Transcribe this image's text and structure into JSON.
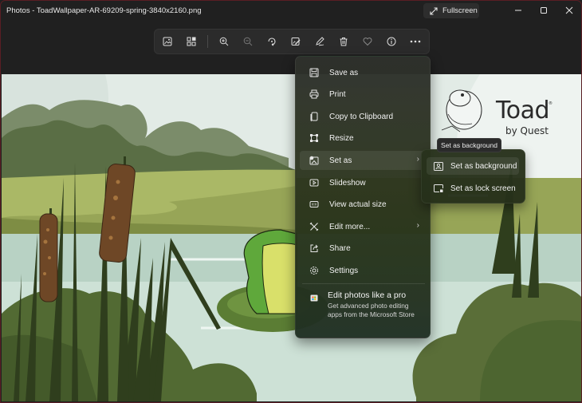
{
  "window": {
    "title": "Photos - ToadWallpaper-AR-69209-spring-3840x2160.png",
    "fullscreen_label": "Fullscreen",
    "accent_border": "#5a1e24"
  },
  "toolbar": {
    "buttons": [
      {
        "icon": "image-view-icon",
        "label": "View image"
      },
      {
        "icon": "gallery-icon",
        "label": "Gallery"
      },
      {
        "icon": "zoom-in-icon",
        "label": "Zoom in"
      },
      {
        "icon": "zoom-out-icon",
        "label": "Zoom out"
      },
      {
        "icon": "rotate-icon",
        "label": "Rotate"
      },
      {
        "icon": "edit-image-icon",
        "label": "Edit image"
      },
      {
        "icon": "markup-icon",
        "label": "Markup"
      },
      {
        "icon": "delete-icon",
        "label": "Delete"
      },
      {
        "icon": "favorite-icon",
        "label": "Favorite"
      },
      {
        "icon": "info-icon",
        "label": "File info"
      },
      {
        "icon": "more-icon",
        "label": "See more"
      }
    ]
  },
  "menu": {
    "items": [
      {
        "label": "Save as",
        "icon": "save-icon"
      },
      {
        "label": "Print",
        "icon": "print-icon"
      },
      {
        "label": "Copy to Clipboard",
        "icon": "copy-icon"
      },
      {
        "label": "Resize",
        "icon": "resize-icon"
      },
      {
        "label": "Set as",
        "icon": "set-as-icon",
        "has_submenu": true
      },
      {
        "label": "Slideshow",
        "icon": "slideshow-icon"
      },
      {
        "label": "View actual size",
        "icon": "actual-size-icon"
      },
      {
        "label": "Edit more...",
        "icon": "edit-more-icon",
        "has_submenu": true
      },
      {
        "label": "Share",
        "icon": "share-icon"
      },
      {
        "label": "Settings",
        "icon": "settings-icon"
      }
    ],
    "chevron": "›",
    "promo": {
      "title": "Edit photos like a pro",
      "description": "Get advanced photo editing apps from the Microsoft Store",
      "icon": "store-icon"
    }
  },
  "submenu": {
    "items": [
      {
        "label": "Set as background",
        "icon": "background-icon"
      },
      {
        "label": "Set as lock screen",
        "icon": "lock-screen-icon"
      }
    ]
  },
  "tooltip": {
    "text": "Set as background"
  },
  "image": {
    "logo_main": "Toad",
    "logo_sub": "by Quest",
    "registered": "®"
  }
}
